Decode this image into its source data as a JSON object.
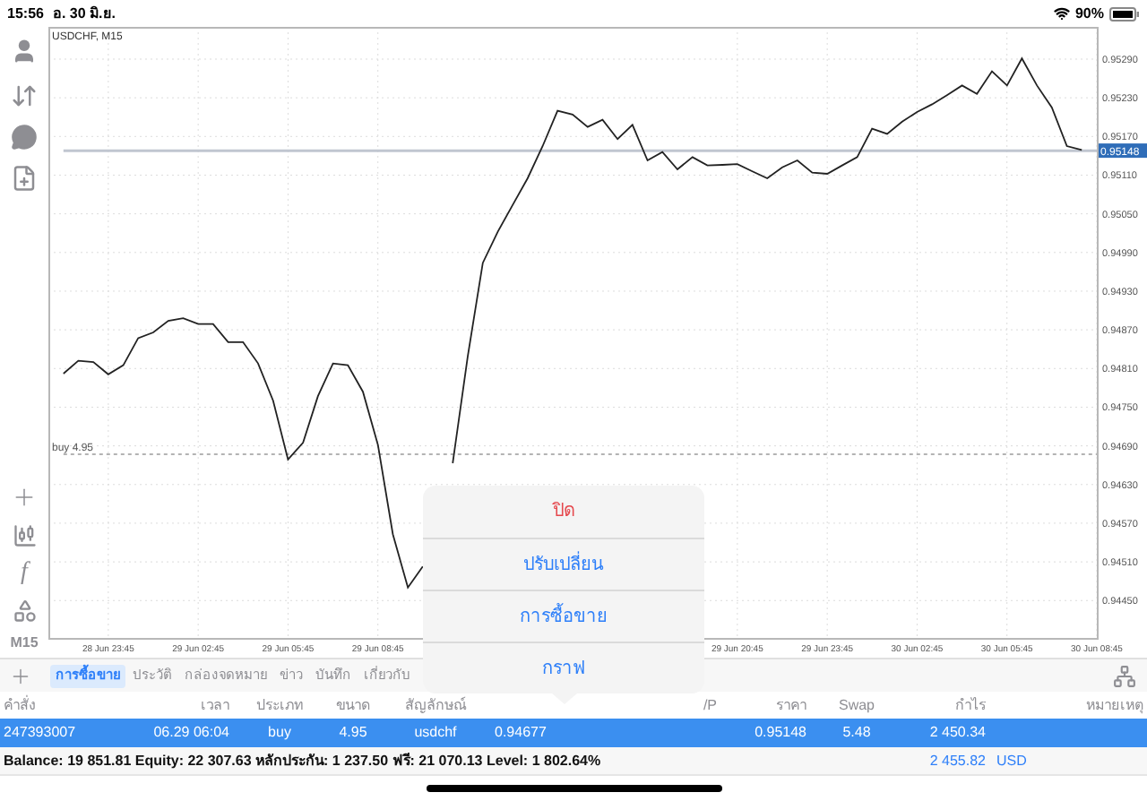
{
  "status_bar": {
    "time": "15:56",
    "date": "อ. 30 มิ.ย.",
    "battery_text": "90%"
  },
  "left_toolbar": {
    "indicator_glyph": "f",
    "timeframe": "M15"
  },
  "chart": {
    "chart_data": {
      "type": "line",
      "title": "USDCHF, M15",
      "categories": [
        null,
        null,
        null,
        "28 Jun 23:45",
        null,
        null,
        null,
        null,
        null,
        "29 Jun 02:45",
        null,
        null,
        null,
        null,
        null,
        "29 Jun 05:45",
        null,
        null,
        null,
        null,
        null,
        "29 Jun 08:45",
        null,
        null,
        null,
        null,
        null,
        null,
        null,
        null,
        null,
        null,
        null,
        null,
        null,
        null,
        null,
        null,
        null,
        null,
        null,
        null,
        null,
        null,
        null,
        "29 Jun 20:45",
        null,
        null,
        null,
        null,
        null,
        "29 Jun 23:45",
        null,
        null,
        null,
        null,
        null,
        "30 Jun 02:45",
        null,
        null,
        null,
        null,
        null,
        "30 Jun 05:45",
        null,
        null,
        null,
        null,
        null,
        "30 Jun 08:45"
      ],
      "grid": true,
      "series": [
        {
          "color": "#222222",
          "values": [
            0.94802,
            0.94822,
            0.9482,
            0.94801,
            0.94815,
            0.94857,
            0.94866,
            0.94884,
            0.94888,
            0.94879,
            0.94879,
            0.94851,
            0.94851,
            0.94818,
            0.9476,
            0.94669,
            0.94695,
            0.94767,
            0.94818,
            0.94815,
            0.94774,
            0.94691,
            0.94553,
            0.9447,
            0.94503,
            null,
            0.94663,
            0.94829,
            0.94974,
            0.95022,
            0.95064,
            0.95105,
            0.95155,
            0.9521,
            0.95204,
            0.95185,
            0.95196,
            0.95166,
            0.95188,
            0.95133,
            0.95146,
            0.95119,
            0.95138,
            0.95125,
            0.95126,
            0.95127,
            0.95116,
            0.95105,
            0.95122,
            0.95133,
            0.95114,
            0.95112,
            0.95125,
            0.95138,
            0.95182,
            0.95174,
            0.95193,
            0.95208,
            0.9522,
            0.95234,
            0.95249,
            0.95236,
            0.95271,
            0.95249,
            0.95291,
            0.95249,
            0.95215,
            0.95155,
            0.95149,
            null
          ]
        },
        {
          "name": "0.95148",
          "color": "#c0c6d0",
          "values": [
            0.95148,
            0.95148,
            0.95148,
            0.95148,
            0.95148,
            0.95148,
            0.95148,
            0.95148,
            0.95148,
            0.95148,
            0.95148,
            0.95148,
            0.95148,
            0.95148,
            0.95148,
            0.95148,
            0.95148,
            0.95148,
            0.95148,
            0.95148,
            0.95148,
            0.95148,
            0.95148,
            0.95148,
            0.95148,
            0.95148,
            0.95148,
            0.95148,
            0.95148,
            0.95148,
            0.95148,
            0.95148,
            0.95148,
            0.95148,
            0.95148,
            0.95148,
            0.95148,
            0.95148,
            0.95148,
            0.95148,
            0.95148,
            0.95148,
            0.95148,
            0.95148,
            0.95148,
            0.95148,
            0.95148,
            0.95148,
            0.95148,
            0.95148,
            0.95148,
            0.95148,
            0.95148,
            0.95148,
            0.95148,
            0.95148,
            0.95148,
            0.95148,
            0.95148,
            0.95148,
            0.95148,
            0.95148,
            0.95148,
            0.95148,
            0.95148,
            0.95148,
            0.95148,
            0.95148,
            0.95148,
            0.95148
          ]
        },
        {
          "name": "buy 4.95",
          "color": "#9a9a9a",
          "line_style": "dashed",
          "values": [
            0.94677,
            0.94677,
            0.94677,
            0.94677,
            0.94677,
            0.94677,
            0.94677,
            0.94677,
            0.94677,
            0.94677,
            0.94677,
            0.94677,
            0.94677,
            0.94677,
            0.94677,
            0.94677,
            0.94677,
            0.94677,
            0.94677,
            0.94677,
            0.94677,
            0.94677,
            0.94677,
            0.94677,
            0.94677,
            0.94677,
            0.94677,
            0.94677,
            0.94677,
            0.94677,
            0.94677,
            0.94677,
            0.94677,
            0.94677,
            0.94677,
            0.94677,
            0.94677,
            0.94677,
            0.94677,
            0.94677,
            0.94677,
            0.94677,
            0.94677,
            0.94677,
            0.94677,
            0.94677,
            0.94677,
            0.94677,
            0.94677,
            0.94677,
            0.94677,
            0.94677,
            0.94677,
            0.94677,
            0.94677,
            0.94677,
            0.94677,
            0.94677,
            0.94677,
            0.94677,
            0.94677,
            0.94677,
            0.94677,
            0.94677,
            0.94677,
            0.94677,
            0.94677,
            0.94677,
            0.94677,
            0.94677
          ]
        }
      ],
      "ylim": [
        0.94392,
        0.9534
      ],
      "yticks": [
        {
          "value": 0.9529,
          "label": "0.95290"
        },
        {
          "value": 0.9523,
          "label": "0.95230"
        },
        {
          "value": 0.9517,
          "label": "0.95170"
        },
        {
          "value": 0.9511,
          "label": "0.95110"
        },
        {
          "value": 0.9505,
          "label": "0.95050"
        },
        {
          "value": 0.9499,
          "label": "0.94990"
        },
        {
          "value": 0.9493,
          "label": "0.94930"
        },
        {
          "value": 0.9487,
          "label": "0.94870"
        },
        {
          "value": 0.9481,
          "label": "0.94810"
        },
        {
          "value": 0.9475,
          "label": "0.94750"
        },
        {
          "value": 0.9469,
          "label": "0.94690"
        },
        {
          "value": 0.9463,
          "label": "0.94630"
        },
        {
          "value": 0.9457,
          "label": "0.94570"
        },
        {
          "value": 0.9451,
          "label": "0.94510"
        },
        {
          "value": 0.9445,
          "label": "0.94450"
        }
      ]
    }
  },
  "tabs": [
    {
      "label": "การซื้อขาย",
      "selected": true
    },
    {
      "label": "ประวัติ",
      "selected": false
    },
    {
      "label": "กล่องจดหมาย",
      "selected": false
    },
    {
      "label": "ข่าว",
      "selected": false
    },
    {
      "label": "บันทึก",
      "selected": false
    },
    {
      "label": "เกี่ยวกับ",
      "selected": false
    }
  ],
  "table": {
    "columns": [
      "คำสั่ง",
      "เวลา",
      "ประเภท",
      "ขนาด",
      "สัญลักษณ์",
      null,
      null,
      "/P",
      "ราคา",
      "Swap",
      "กำไร",
      "หมายเหตุ"
    ],
    "rows": [
      {
        "selected": true,
        "cells": [
          "247393007",
          "06.29 06:04",
          "buy",
          "4.95",
          "usdchf",
          "0.94677",
          null,
          null,
          "0.95148",
          "5.48",
          "2 450.34",
          null
        ]
      }
    ]
  },
  "summary": {
    "text": "Balance: 19 851.81 Equity: 22 307.63 หลักประกัน: 1 237.50 ฟรี: 21 070.13 Level: 1 802.64%",
    "profit": "2 455.82",
    "currency": "USD"
  },
  "action_menu": {
    "items": [
      {
        "label": "ปิด",
        "kind": "destructive"
      },
      {
        "label": "ปรับเปลี่ยน",
        "kind": "default"
      },
      {
        "label": "การซื้อขาย",
        "kind": "default"
      },
      {
        "label": "กราฟ",
        "kind": "default"
      }
    ]
  }
}
